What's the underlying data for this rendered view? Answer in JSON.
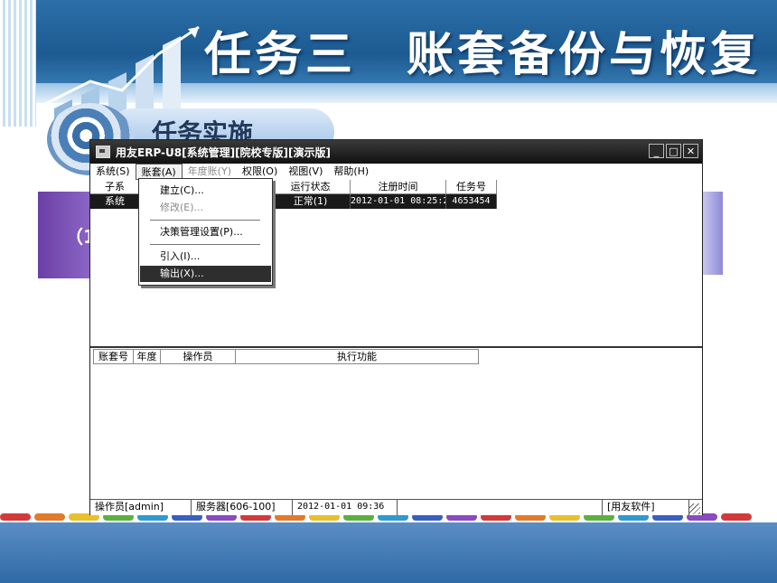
{
  "slide": {
    "title": "任务三　账套备份与恢复",
    "subtitle": "任务实施",
    "left_label": "（1"
  },
  "window": {
    "title": "用友ERP-U8[系统管理][院校专版][演示版]",
    "controls": {
      "minimize": "_",
      "maximize": "□",
      "close": "✕"
    }
  },
  "menu": [
    {
      "label": "系统(S)",
      "state": "normal"
    },
    {
      "label": "账套(A)",
      "state": "active"
    },
    {
      "label": "年度账(Y)",
      "state": "disabled"
    },
    {
      "label": "权限(O)",
      "state": "normal"
    },
    {
      "label": "视图(V)",
      "state": "normal"
    },
    {
      "label": "帮助(H)",
      "state": "normal"
    }
  ],
  "dropdown": {
    "items": [
      {
        "label": "建立(C)...",
        "state": "normal"
      },
      {
        "label": "修改(E)...",
        "state": "disabled"
      },
      {
        "label": "决策管理设置(P)...",
        "state": "normal"
      },
      {
        "label": "引入(I)...",
        "state": "normal"
      },
      {
        "label": "输出(X)...",
        "state": "highlighted"
      }
    ]
  },
  "upper_table": {
    "headers": [
      "子系",
      "运行状态",
      "注册时间",
      "任务号"
    ],
    "row": [
      "系统",
      "正常(1)",
      "2012-01-01 08:25:29",
      "4653454"
    ]
  },
  "lower_table": {
    "headers": [
      "账套号",
      "年度",
      "操作员",
      "执行功能"
    ]
  },
  "status_bar": {
    "operator": "操作员[admin]",
    "server": "服务器[606-100]",
    "datetime": "2012-01-01 09:36",
    "brand": "[用友软件]"
  },
  "colors": {
    "header_blue": "#2c6fa8",
    "window_title": "#111111",
    "selection": "#1a1a1a",
    "accent_purple": "#6b3fa6"
  },
  "decor_dot_colors": [
    "#d23a3a",
    "#e27a2a",
    "#e8c12a",
    "#5cb040",
    "#2e9ad0",
    "#3a5fc0",
    "#8a4ac0",
    "#d23a3a",
    "#e27a2a",
    "#e8c12a",
    "#5cb040",
    "#2e9ad0",
    "#3a5fc0",
    "#8a4ac0",
    "#d23a3a",
    "#e27a2a",
    "#e8c12a",
    "#5cb040",
    "#2e9ad0",
    "#3a5fc0",
    "#8a4ac0",
    "#d23a3a"
  ]
}
